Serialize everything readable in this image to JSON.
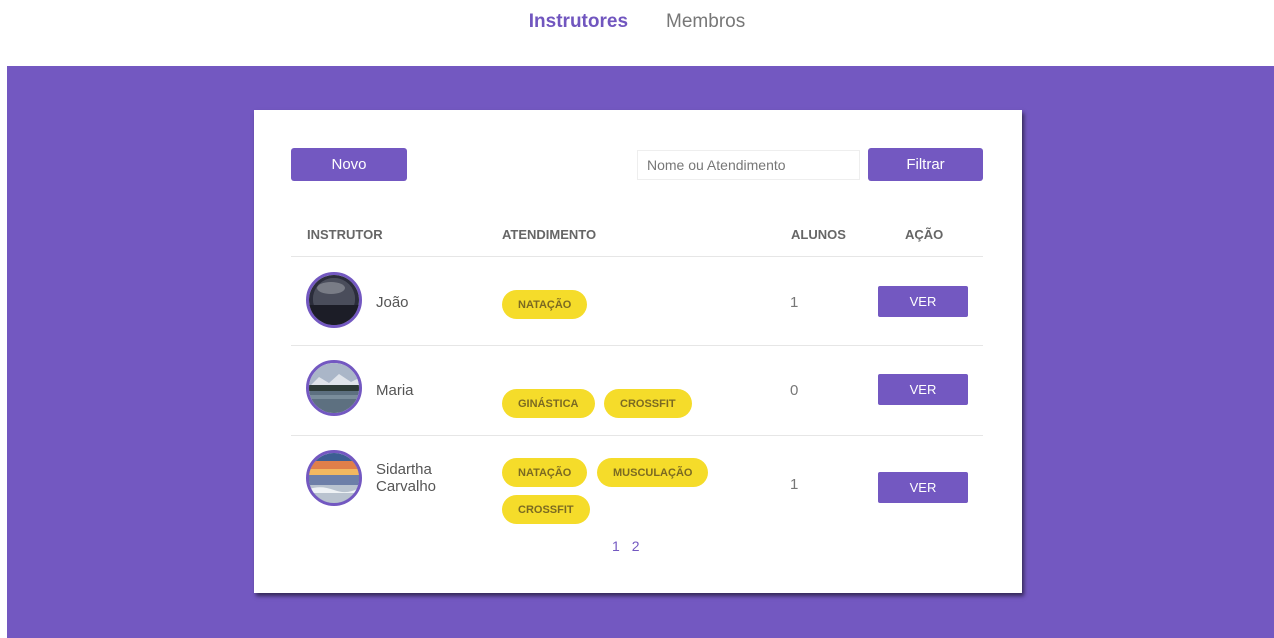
{
  "nav": {
    "instructors": "Instrutores",
    "members": "Membros"
  },
  "toolbar": {
    "new_label": "Novo",
    "search_placeholder": "Nome ou Atendimento",
    "filter_label": "Filtrar"
  },
  "table": {
    "headers": [
      "INSTRUTOR",
      "ATENDIMENTO",
      "ALUNOS",
      "AÇÃO"
    ],
    "rows": [
      {
        "name": "João",
        "services": [
          "NATAÇÃO"
        ],
        "students": "1",
        "action": "VER",
        "avatar": "moon-photo"
      },
      {
        "name": "Maria",
        "services": [
          "GINÁSTICA",
          "CROSSFIT"
        ],
        "students": "0",
        "action": "VER",
        "avatar": "lake-mountain-photo"
      },
      {
        "name_line1": "Sidartha",
        "name_line2": "Carvalho",
        "services": [
          "NATAÇÃO",
          "MUSCULAÇÃO",
          "CROSSFIT"
        ],
        "students": "1",
        "action": "VER",
        "avatar": "beach-sunset-photo"
      }
    ]
  },
  "pagination": [
    "1",
    "2"
  ],
  "colors": {
    "accent": "#7358c1",
    "tag": "#f5dc2a",
    "tag_text": "#7b6a22"
  }
}
